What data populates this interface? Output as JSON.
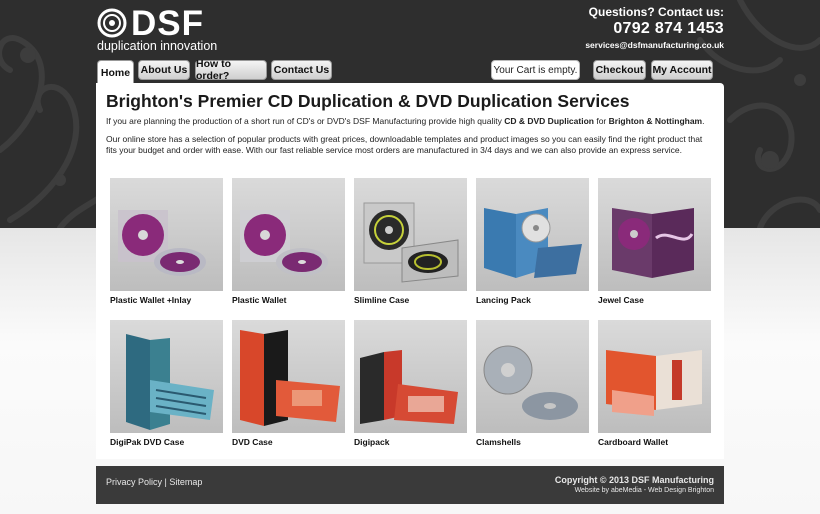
{
  "header": {
    "logo_text": "DSF",
    "tagline": "duplication innovation",
    "contact_heading": "Questions? Contact us:",
    "phone": "0792 874 1453",
    "email": "services@dsfmanufacturing.co.uk"
  },
  "nav": {
    "tabs": [
      {
        "label": "Home"
      },
      {
        "label": "About Us"
      },
      {
        "label": "How to order?"
      },
      {
        "label": "Contact Us"
      }
    ],
    "cart_status": "Your Cart is empty.",
    "checkout_label": "Checkout",
    "account_label": "My Account"
  },
  "main": {
    "title": "Brighton's Premier CD Duplication & DVD Duplication Services",
    "intro_1_prefix": "If you are planning the production of a short run of CD's or DVD's DSF Manufacturing provide high quality ",
    "intro_1_bold_1": "CD & DVD Duplication",
    "intro_1_mid": " for ",
    "intro_1_bold_2": "Brighton & Nottingham",
    "intro_1_suffix": ".",
    "intro_2": "Our online store has a selection of popular products with great prices, downloadable templates and product images so you can easily find the right product that fits your budget and order with ease. With our fast reliable service most orders are manufactured in 3/4 days and we can also provide an express service."
  },
  "products": [
    {
      "name": "Plastic Wallet +Inlay"
    },
    {
      "name": "Plastic Wallet"
    },
    {
      "name": "Slimline Case"
    },
    {
      "name": "Lancing Pack"
    },
    {
      "name": "Jewel Case"
    },
    {
      "name": "DigiPak DVD Case"
    },
    {
      "name": "DVD Case"
    },
    {
      "name": "Digipack"
    },
    {
      "name": "Clamshells"
    },
    {
      "name": "Cardboard Wallet"
    }
  ],
  "footer": {
    "privacy_label": "Privacy Policy",
    "separator": "|",
    "sitemap_label": "Sitemap",
    "copyright": "Copyright © 2013 DSF Manufacturing",
    "credit": "Website by abeMedia - Web Design Brighton"
  },
  "colors": {
    "header_bg": "#2e2e2e",
    "footer_bg": "#3a3a3a",
    "disc_purple": "#8a2a7a",
    "case_blue": "#3a7ab0",
    "case_red": "#d8472a"
  }
}
